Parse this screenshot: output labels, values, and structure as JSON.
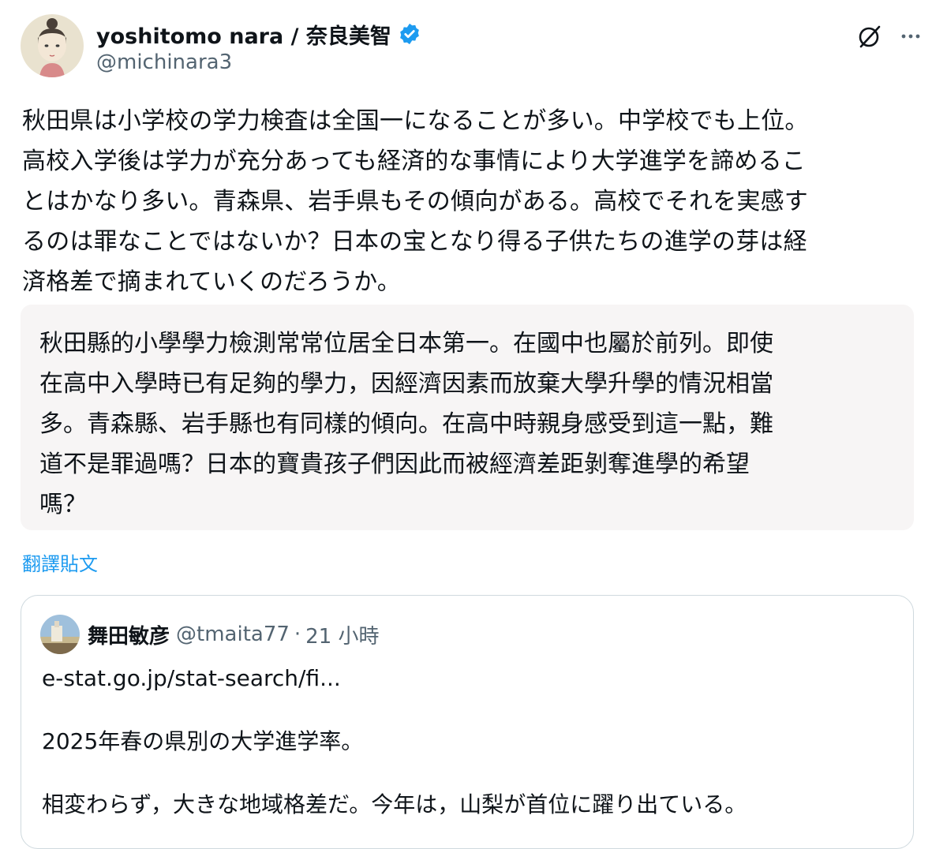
{
  "author": {
    "display_name": "yoshitomo nara / 奈良美智",
    "handle": "@michinara3",
    "verified": true
  },
  "actions": {
    "grok_icon": "grok-icon",
    "more_icon": "more-icon"
  },
  "tweet": {
    "text": "秋田県は小学校の学力検査は全国一になることが多い。中学校でも上位。\n高校入学後は学力が充分あっても経済的な事情により大学進学を諦めるこ\nとはかなり多い。青森県、岩手県もその傾向がある。高校でそれを実感す\nるのは罪なことではないか？日本の宝となり得る子供たちの進学の芽は経\n済格差で摘まれていくのだろうか。"
  },
  "translation": {
    "text": "秋田縣的小學學力檢測常常位居全日本第一。在國中也屬於前列。即使\n在高中入學時已有足夠的學力，因經濟因素而放棄大學升學的情況相當\n多。青森縣、岩手縣也有同樣的傾向。在高中時親身感受到這一點，難\n道不是罪過嗎？日本的寶貴孩子們因此而被經濟差距剝奪進學的希望\n嗎？",
    "link_label": "翻譯貼文"
  },
  "quote": {
    "display_name": "舞田敏彦",
    "handle": "@tmaita77",
    "separator": "·",
    "time": "21 小時",
    "lines": {
      "link": "e-stat.go.jp/stat-search/fi...",
      "line1": "2025年春の県別の大学進学率。",
      "line2": "相変わらず，大きな地域格差だ。今年は，山梨が首位に躍り出ている。"
    }
  },
  "colors": {
    "accent": "#1d9bf0",
    "secondary_text": "#536471",
    "translation_bg": "#f7f5f5",
    "border": "#cfd9de"
  }
}
